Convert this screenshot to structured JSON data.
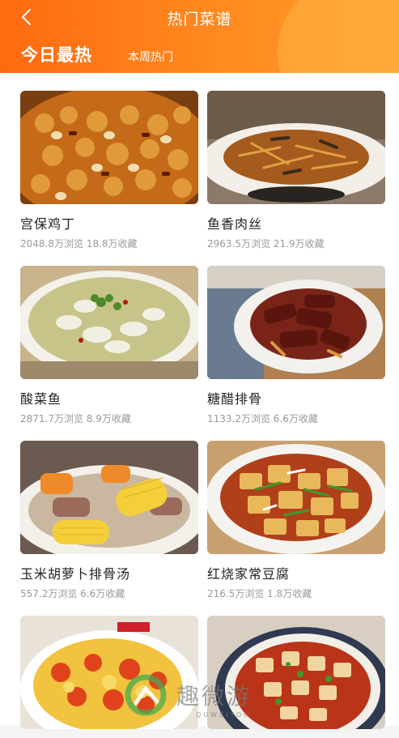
{
  "header": {
    "title": "热门菜谱",
    "tabs": [
      {
        "label": "今日最热",
        "active": true
      },
      {
        "label": "本周热门",
        "active": false
      }
    ],
    "back_icon": "chevron-left-icon"
  },
  "recipes": [
    {
      "name": "宫保鸡丁",
      "stats": "2048.8万浏览 18.8万收藏"
    },
    {
      "name": "鱼香肉丝",
      "stats": "2963.5万浏览 21.9万收藏"
    },
    {
      "name": "酸菜鱼",
      "stats": "2871.7万浏览 8.9万收藏"
    },
    {
      "name": "糖醋排骨",
      "stats": "1133.2万浏览 6.6万收藏"
    },
    {
      "name": "玉米胡萝卜排骨汤",
      "stats": "557.2万浏览 6.6万收藏"
    },
    {
      "name": "红烧家常豆腐",
      "stats": "216.5万浏览 1.8万收藏"
    },
    {
      "name": "",
      "stats": ""
    },
    {
      "name": "",
      "stats": ""
    }
  ],
  "watermark": {
    "text": "趣微游",
    "sub": "QUWEIYOU"
  },
  "colors": {
    "header_start": "#ff6a10",
    "header_end": "#ff9a2a",
    "muted_text": "#9a9a9a"
  }
}
